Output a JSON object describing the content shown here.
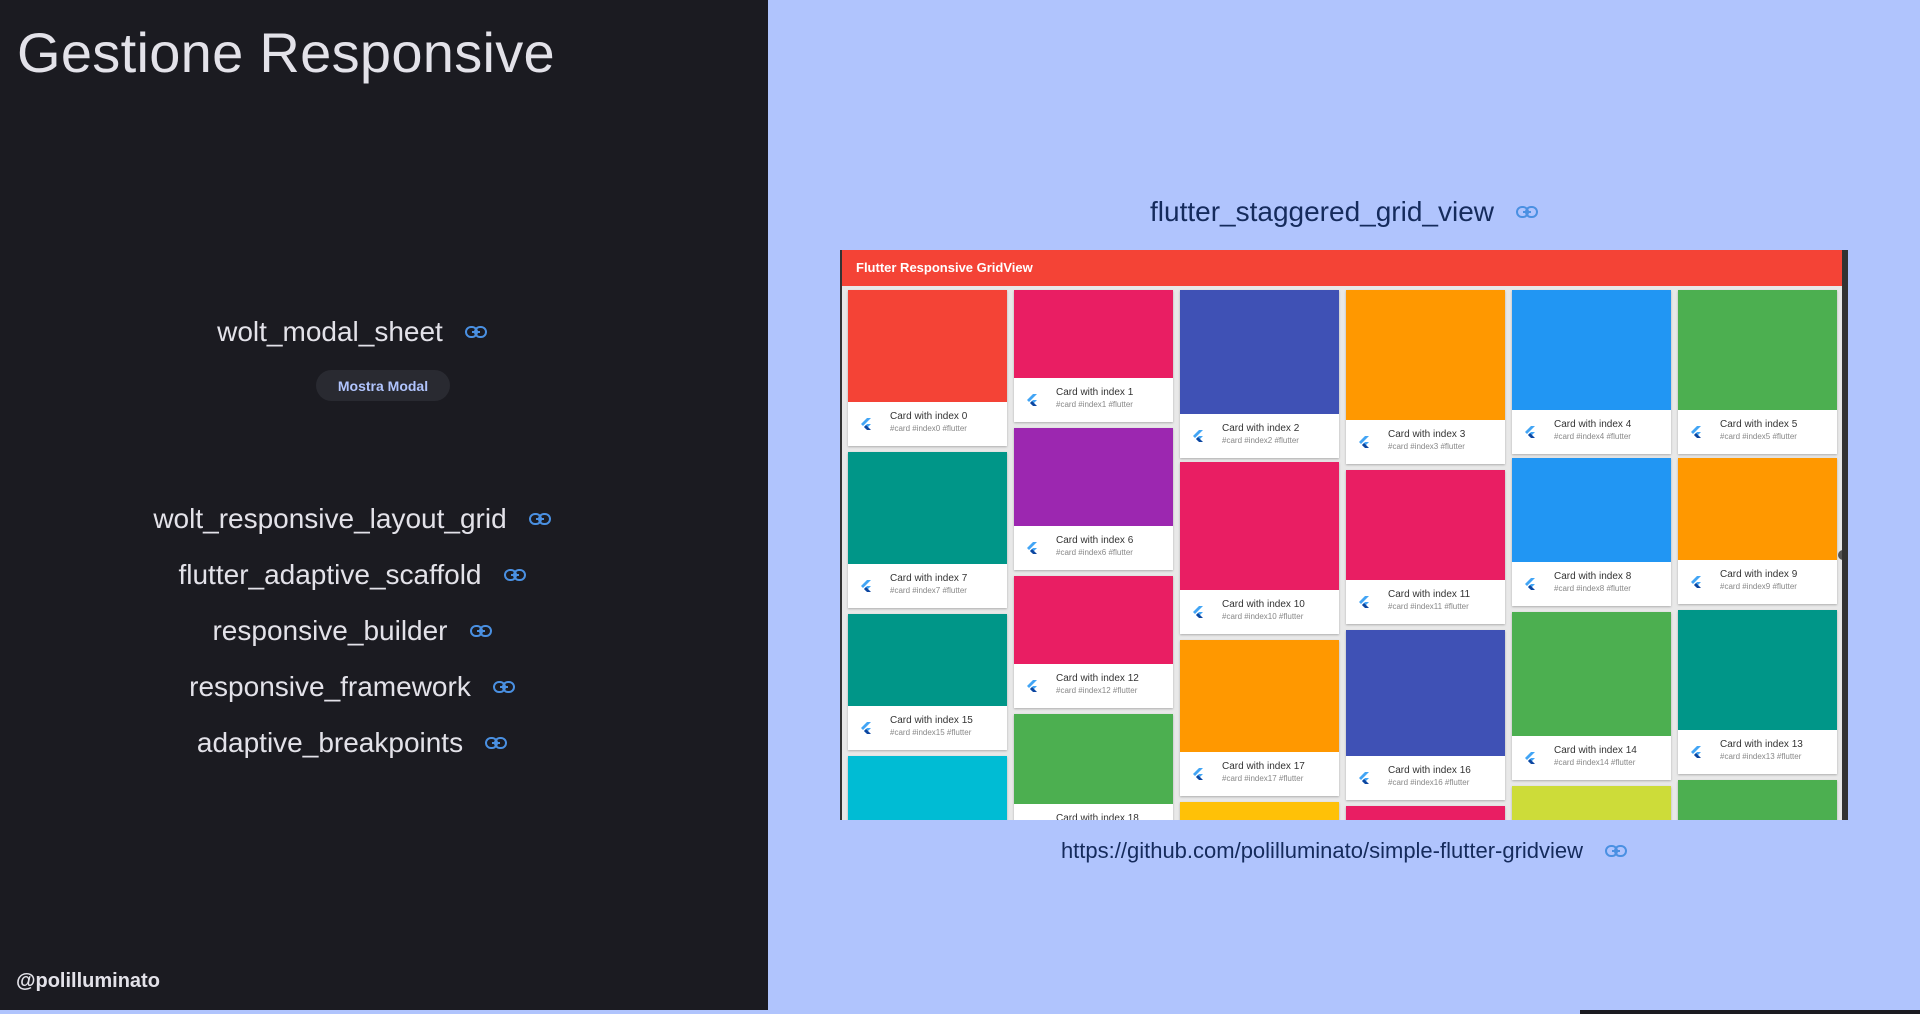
{
  "slide": {
    "title": "Gestione Responsive",
    "handle": "@polilluminato"
  },
  "packages": [
    {
      "label": "wolt_modal_sheet",
      "icon": "link-icon"
    },
    {
      "label": "wolt_responsive_layout_grid",
      "icon": "link-icon"
    },
    {
      "label": "flutter_adaptive_scaffold",
      "icon": "link-icon"
    },
    {
      "label": "responsive_builder",
      "icon": "link-icon"
    },
    {
      "label": "responsive_framework",
      "icon": "link-icon"
    },
    {
      "label": "adaptive_breakpoints",
      "icon": "link-icon"
    }
  ],
  "modal_button": {
    "label": "Mostra Modal"
  },
  "right": {
    "package": "flutter_staggered_grid_view",
    "repo_url": "https://github.com/polilluminato/simple-flutter-gridview"
  },
  "screenshot": {
    "app_title": "Flutter Responsive GridView",
    "cards": [
      {
        "title": "Card with index 0",
        "tags": "#card #index0 #flutter",
        "color": "#f44336"
      },
      {
        "title": "Card with index 1",
        "tags": "#card #index1 #flutter",
        "color": "#e91e63"
      },
      {
        "title": "Card with index 2",
        "tags": "#card #index2 #flutter",
        "color": "#3f51b5"
      },
      {
        "title": "Card with index 3",
        "tags": "#card #index3 #flutter",
        "color": "#ff9800"
      },
      {
        "title": "Card with index 4",
        "tags": "#card #index4 #flutter",
        "color": "#2196f3"
      },
      {
        "title": "Card with index 5",
        "tags": "#card #index5 #flutter",
        "color": "#4caf50"
      },
      {
        "title": "Card with index 6",
        "tags": "#card #index6 #flutter",
        "color": "#9c27b0"
      },
      {
        "title": "Card with index 7",
        "tags": "#card #index7 #flutter",
        "color": "#009688"
      },
      {
        "title": "Card with index 8",
        "tags": "#card #index8 #flutter",
        "color": "#2196f3"
      },
      {
        "title": "Card with index 9",
        "tags": "#card #index9 #flutter",
        "color": "#ff9800"
      },
      {
        "title": "Card with index 10",
        "tags": "#card #index10 #flutter",
        "color": "#e91e63"
      },
      {
        "title": "Card with index 11",
        "tags": "#card #index11 #flutter",
        "color": "#e91e63"
      },
      {
        "title": "Card with index 12",
        "tags": "#card #index12 #flutter",
        "color": "#e91e63"
      },
      {
        "title": "Card with index 13",
        "tags": "#card #index13 #flutter",
        "color": "#009688"
      },
      {
        "title": "Card with index 14",
        "tags": "#card #index14 #flutter",
        "color": "#4caf50"
      },
      {
        "title": "Card with index 15",
        "tags": "#card #index15 #flutter",
        "color": "#009688"
      },
      {
        "title": "Card with index 16",
        "tags": "#card #index16 #flutter",
        "color": "#3f51b5"
      },
      {
        "title": "Card with index 17",
        "tags": "#card #index17 #flutter",
        "color": "#ff9800"
      },
      {
        "title": "Card with index 18",
        "tags": "",
        "color": "#4caf50"
      },
      {
        "title": "",
        "tags": "",
        "color": "#00bcd4"
      },
      {
        "title": "",
        "tags": "",
        "color": "#ffc107"
      },
      {
        "title": "",
        "tags": "",
        "color": "#e91e63"
      },
      {
        "title": "",
        "tags": "",
        "color": "#cddc39"
      },
      {
        "title": "",
        "tags": "",
        "color": "#4caf50"
      }
    ]
  },
  "colors": {
    "left_bg": "#1b1b21",
    "right_bg": "#b0c4fd",
    "link_icon": "#4a90e2",
    "app_bar": "#f44336"
  }
}
